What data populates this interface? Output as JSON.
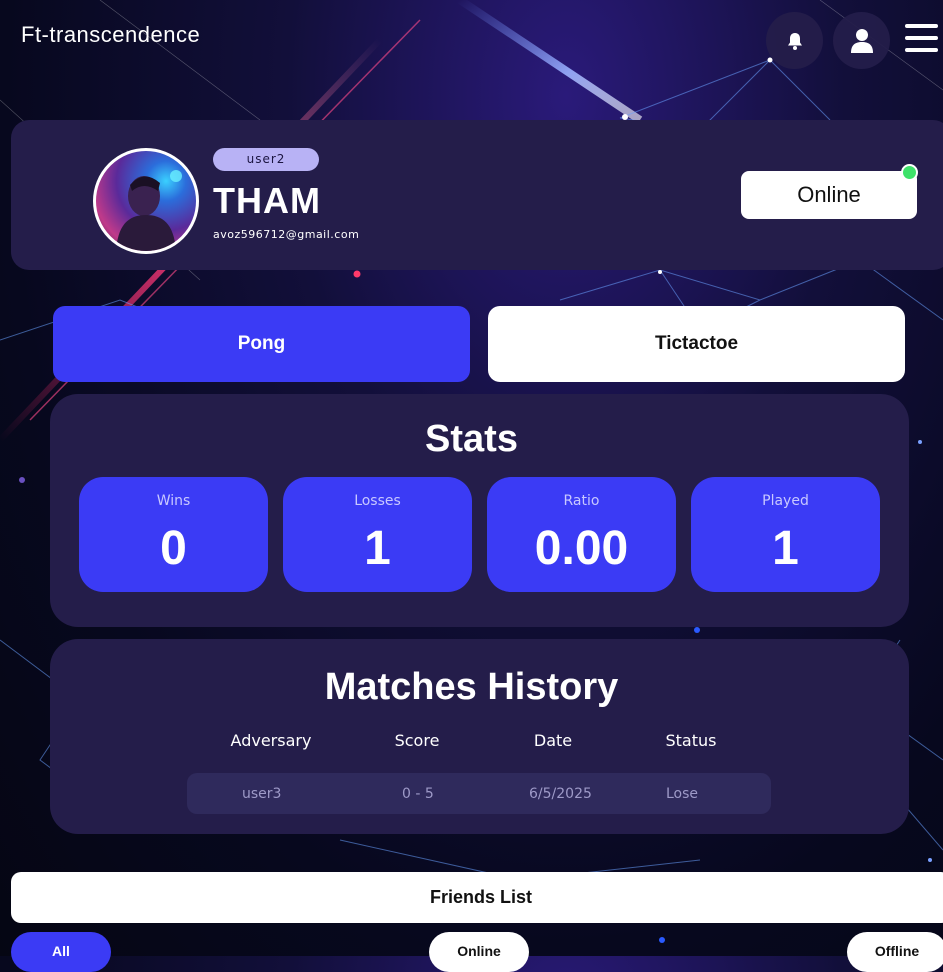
{
  "app": {
    "brand": "Ft-transcendence"
  },
  "header": {
    "icons": [
      "bell-icon",
      "user-icon",
      "hamburger-menu-icon"
    ]
  },
  "profile": {
    "username": "user2",
    "display_name": "THAM",
    "email": "avoz596712@gmail.com",
    "status": "Online",
    "status_color": "#3ee26a"
  },
  "tabs": [
    {
      "label": "Pong",
      "active": true
    },
    {
      "label": "Tictactoe",
      "active": false
    }
  ],
  "stats": {
    "title": "Stats",
    "cards": [
      {
        "label": "Wins",
        "value": "0"
      },
      {
        "label": "Losses",
        "value": "1"
      },
      {
        "label": "Ratio",
        "value": "0.00"
      },
      {
        "label": "Played",
        "value": "1"
      }
    ]
  },
  "matches": {
    "title": "Matches History",
    "columns": [
      "Adversary",
      "Score",
      "Date",
      "Status"
    ],
    "rows": [
      {
        "adversary": "user3",
        "score": "0 - 5",
        "date": "6/5/2025",
        "status": "Lose"
      }
    ]
  },
  "friends": {
    "title": "Friends List",
    "filters": [
      "All",
      "Online",
      "Offline"
    ]
  },
  "colors": {
    "accent": "#3b3bf5",
    "panel": "#241d4a",
    "online": "#3ee26a"
  }
}
